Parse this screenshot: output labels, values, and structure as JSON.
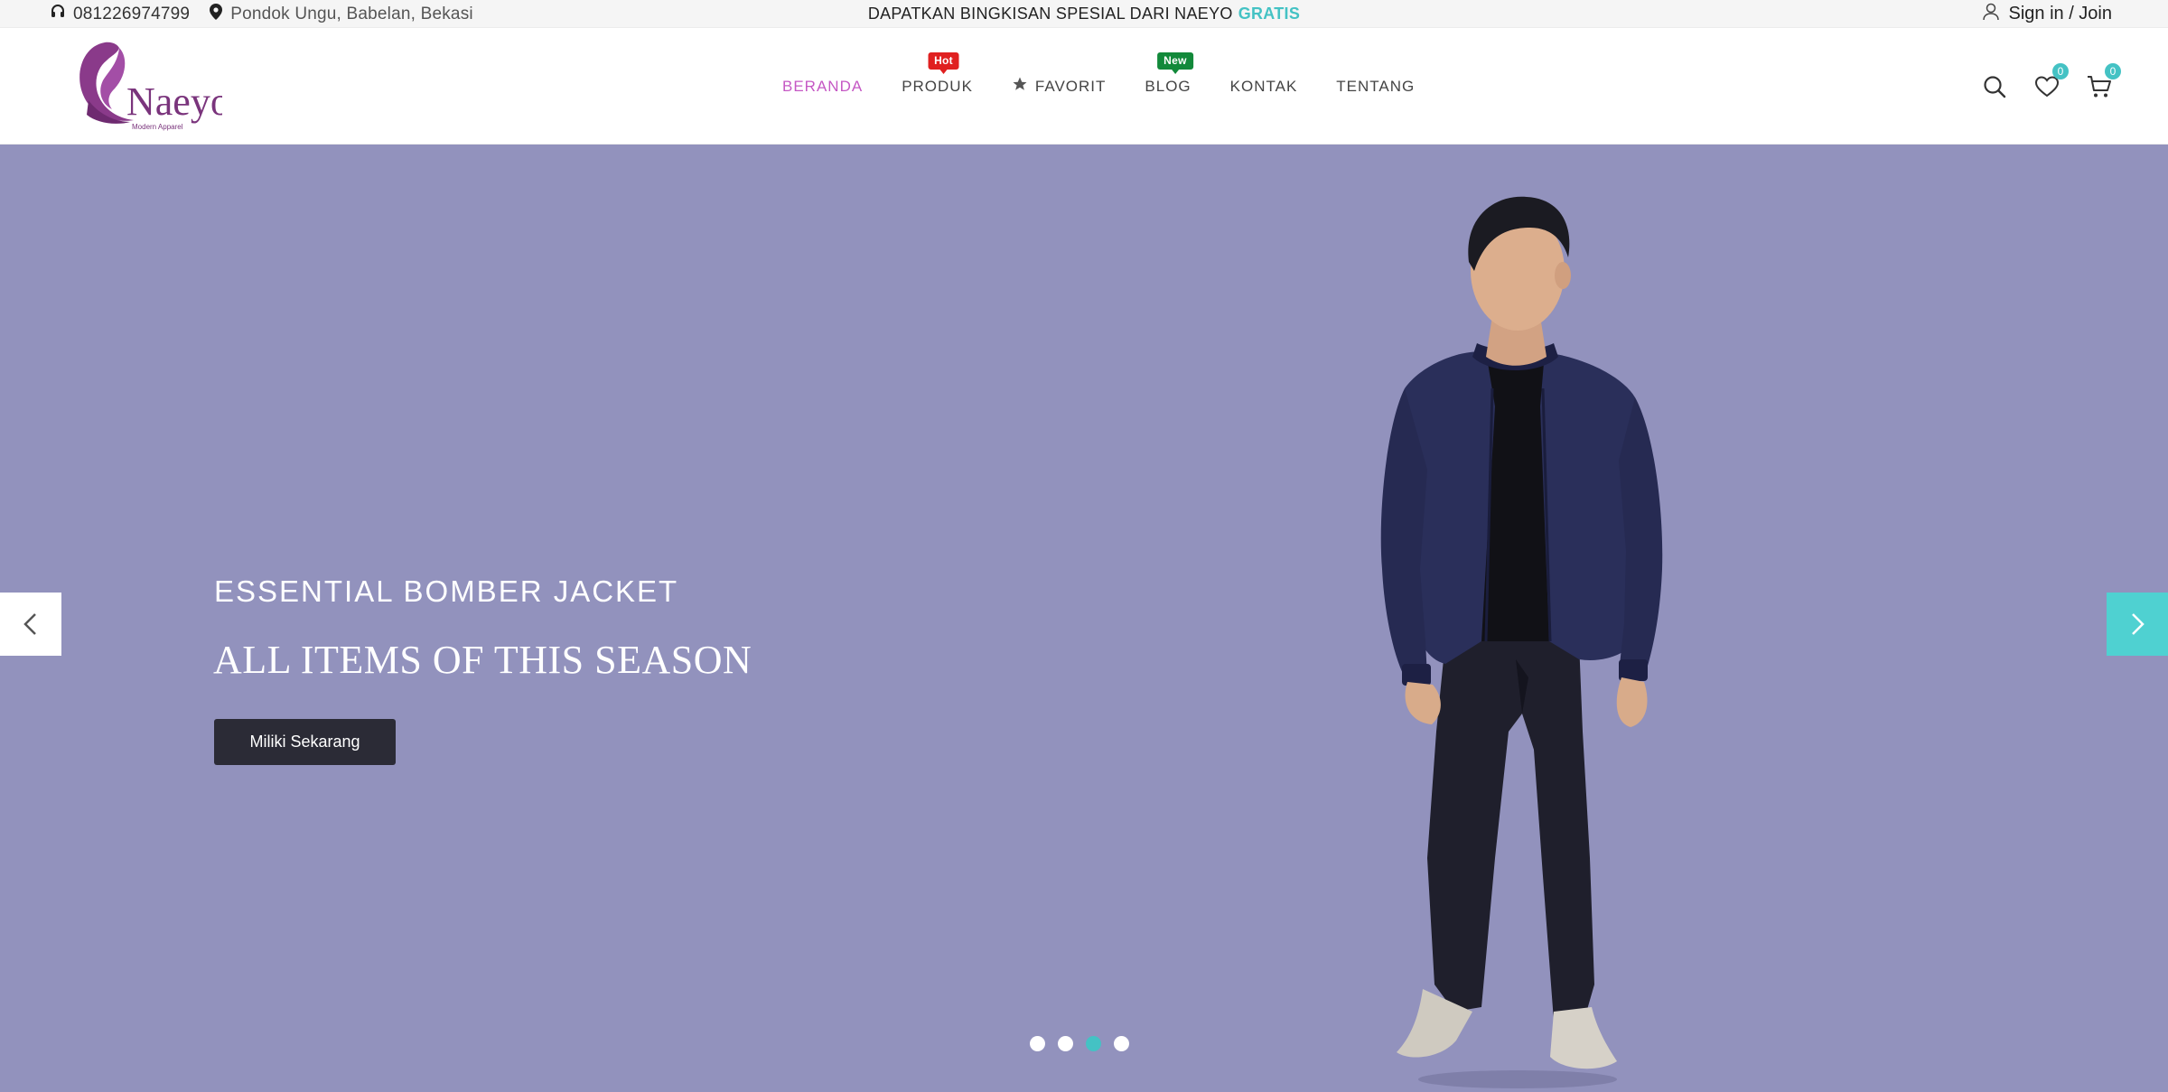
{
  "topbar": {
    "phone": "081226974799",
    "address": "Pondok Ungu, Babelan, Bekasi",
    "promo_text": "DAPATKAN BINGKISAN SPESIAL DARI NAEYO",
    "promo_accent": "GRATIS",
    "signin": "Sign in / Join"
  },
  "logo": {
    "brand": "Naeyo",
    "tagline": "Modern Apparel"
  },
  "nav": {
    "items": [
      {
        "label": "BERANDA",
        "active": true
      },
      {
        "label": "PRODUK",
        "badge": "Hot"
      },
      {
        "label": "FAVORIT"
      },
      {
        "label": "BLOG",
        "badge": "New"
      },
      {
        "label": "KONTAK"
      },
      {
        "label": "TENTANG"
      }
    ]
  },
  "header_icons": {
    "wishlist_count": "0",
    "cart_count": "0"
  },
  "hero": {
    "subtitle": "ESSENTIAL BOMBER JACKET",
    "title": "ALL ITEMS OF THIS SEASON",
    "cta_label": "Miliki Sekarang",
    "slide_count": 4,
    "active_slide": 3
  },
  "colors": {
    "accent_teal": "#44c2c4",
    "brand_purple": "#c558c4",
    "hero_bg": "#9292bd",
    "hot_badge": "#e02020",
    "new_badge": "#12893a"
  }
}
